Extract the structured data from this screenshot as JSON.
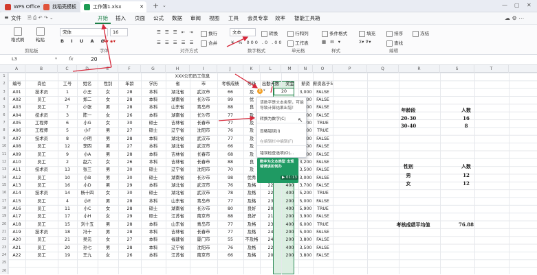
{
  "tabs": [
    {
      "label": "WPS Office",
      "color": "#d23b2e"
    },
    {
      "label": "找稻壳模板",
      "color": "#e0533b"
    },
    {
      "label": "工作簿1.xlsx",
      "color": "#1c9b53"
    }
  ],
  "menu": [
    "文件",
    "开始",
    "插入",
    "页面",
    "公式",
    "数据",
    "审阅",
    "视图",
    "工具",
    "会员专享",
    "效率",
    "智能工具箱"
  ],
  "ribbon": {
    "format_painter": "格式刷",
    "paste": "粘贴",
    "font": "宋体",
    "size": "16",
    "wrap": "换行",
    "merge": "合并",
    "numfmt": "文本",
    "convert": "转换",
    "rowcol": "行和列",
    "worksheet": "工作表",
    "cond": "条件格式",
    "fill": "填充",
    "sort": "排序",
    "freeze": "冻结",
    "find": "查找",
    "groups": [
      "剪贴板",
      "字体",
      "对齐方式",
      "数字格式",
      "单元格",
      "样式",
      "编辑"
    ]
  },
  "formula": {
    "ref": "L3",
    "fx": "fx",
    "value": "20"
  },
  "cols": [
    "A",
    "B",
    "C",
    "D",
    "E",
    "F",
    "G",
    "H",
    "I",
    "J",
    "K",
    "L",
    "M",
    "N",
    "O",
    "P",
    "Q",
    "R",
    "S",
    "T"
  ],
  "title": "XXX公司员工信息",
  "headers": [
    "编号",
    "岗位",
    "工号",
    "姓名",
    "性别",
    "年龄",
    "学历",
    "省",
    "市",
    "考核成绩",
    "等级",
    "出勤天数",
    "奖金",
    "薪资",
    "薪资高于5000"
  ],
  "rows": [
    [
      "A01",
      "技术员",
      "1",
      "小王",
      "女",
      "28",
      "本科",
      "湖北省",
      "武汉市",
      "66",
      "及",
      "20",
      "200",
      "3,000",
      "FALSE"
    ],
    [
      "A02",
      "员工",
      "24",
      "郑二",
      "女",
      "28",
      "本科",
      "湖南省",
      "长沙市",
      "99",
      "优",
      "",
      "400",
      "3,900",
      "FALSE"
    ],
    [
      "A03",
      "员工",
      "7",
      "小张",
      "男",
      "28",
      "本科",
      "山东省",
      "青岛市",
      "88",
      "良",
      "",
      "200",
      "3,800",
      "FALSE"
    ],
    [
      "A04",
      "技术员",
      "3",
      "陈一",
      "女",
      "26",
      "本科",
      "湖南省",
      "长沙市",
      "77",
      "及",
      "",
      "400",
      "3,200",
      "FALSE"
    ],
    [
      "A05",
      "工程师",
      "6",
      "小G",
      "女",
      "30",
      "硕士",
      "吉林省",
      "长春市",
      "77",
      "及",
      "",
      "400",
      "5,300",
      "TRUE"
    ],
    [
      "A06",
      "工程师",
      "5",
      "小F",
      "男",
      "27",
      "硕士",
      "辽宁省",
      "沈阳市",
      "76",
      "及",
      "",
      "400",
      "5,500",
      "TRUE"
    ],
    [
      "A07",
      "技术员",
      "8",
      "小明",
      "男",
      "28",
      "本科",
      "湖北省",
      "武汉市",
      "77",
      "及",
      "",
      "400",
      "3,100",
      "FALSE"
    ],
    [
      "A08",
      "员工",
      "12",
      "李四",
      "男",
      "27",
      "本科",
      "湖北省",
      "武汉市",
      "66",
      "及",
      "",
      "400",
      "3,600",
      "FALSE"
    ],
    [
      "A09",
      "员工",
      "9",
      "小A",
      "男",
      "28",
      "本科",
      "吉林省",
      "长春市",
      "68",
      "及",
      "",
      "400",
      "3,000",
      "FALSE"
    ],
    [
      "A10",
      "员工",
      "2",
      "赵六",
      "女",
      "26",
      "本科",
      "吉林省",
      "长春市",
      "88",
      "良",
      "",
      "200",
      "3,200",
      "FALSE"
    ],
    [
      "A11",
      "技术员",
      "13",
      "张三",
      "男",
      "30",
      "硕士",
      "辽宁省",
      "沈阳市",
      "70",
      "及",
      "",
      "400",
      "3,500",
      "FALSE"
    ],
    [
      "A12",
      "员工",
      "10",
      "小B",
      "男",
      "30",
      "硕士",
      "湖南省",
      "长沙市",
      "98",
      "优秀",
      "24",
      "200",
      "3,000",
      "FALSE"
    ],
    [
      "A13",
      "员工",
      "16",
      "小D",
      "男",
      "29",
      "本科",
      "湖北省",
      "武汉市",
      "76",
      "及格",
      "22",
      "400",
      "3,700",
      "FALSE"
    ],
    [
      "A14",
      "技术员",
      "14",
      "杨十四",
      "女",
      "30",
      "硕士",
      "湖北省",
      "武汉市",
      "78",
      "及格",
      "22",
      "400",
      "5,200",
      "TRUE"
    ],
    [
      "A15",
      "员工",
      "4",
      "小E",
      "男",
      "28",
      "本科",
      "山东省",
      "青岛市",
      "77",
      "及格",
      "23",
      "200",
      "5,000",
      "FALSE"
    ],
    [
      "A16",
      "员工",
      "11",
      "小C",
      "女",
      "28",
      "硕士",
      "湖南省",
      "长沙市",
      "80",
      "良好",
      "20",
      "400",
      "5,900",
      "TRUE"
    ],
    [
      "A17",
      "员工",
      "17",
      "小H",
      "女",
      "29",
      "硕士",
      "江苏省",
      "南京市",
      "88",
      "良好",
      "21",
      "200",
      "3,900",
      "FALSE"
    ],
    [
      "A18",
      "员工",
      "15",
      "刘十五",
      "男",
      "28",
      "本科",
      "山东省",
      "青岛市",
      "77",
      "及格",
      "23",
      "400",
      "6,000",
      "TRUE"
    ],
    [
      "A19",
      "技术员",
      "18",
      "冯十",
      "男",
      "28",
      "本科",
      "吉林省",
      "长春市",
      "77",
      "及格",
      "24",
      "200",
      "5,000",
      "FALSE"
    ],
    [
      "A20",
      "员工",
      "21",
      "吴元",
      "女",
      "27",
      "本科",
      "福建省",
      "厦门市",
      "55",
      "不及格",
      "24",
      "200",
      "3,800",
      "FALSE"
    ],
    [
      "A21",
      "员工",
      "20",
      "孙七",
      "男",
      "28",
      "本科",
      "辽宁省",
      "沈阳市",
      "76",
      "及格",
      "22",
      "400",
      "3,500",
      "FALSE"
    ],
    [
      "A22",
      "员工",
      "19",
      "王九",
      "女",
      "26",
      "本科",
      "江苏省",
      "南京市",
      "66",
      "及格",
      "20",
      "200",
      "3,800",
      "FALSE"
    ]
  ],
  "summary": {
    "age_h": [
      "年龄段",
      "人数"
    ],
    "age": [
      [
        "20-30",
        "16"
      ],
      [
        "30-40",
        "8"
      ]
    ],
    "sex_h": [
      "性别",
      "人数"
    ],
    "sex": [
      [
        "男",
        "12"
      ],
      [
        "女",
        "12"
      ]
    ],
    "avg_label": "考核成绩平均值",
    "avg_value": "76.88"
  },
  "popup": {
    "tip": "该数字是文本类型，可能导致计算结果出错！",
    "items": [
      "转换为数字(C)",
      "忽略错误(I)",
      "在编辑栏中编辑(F)",
      "错误检查选项(O)..."
    ],
    "video_title": "数字为文本类型 出现错误该如何办",
    "video_time": "01:13"
  }
}
